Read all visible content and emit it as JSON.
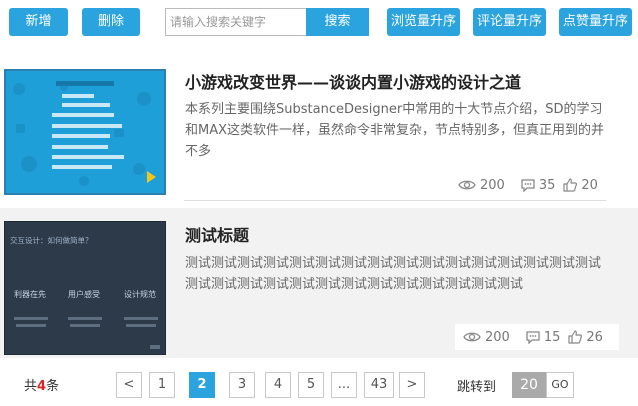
{
  "toolbar": {
    "add_label": "新增",
    "delete_label": "删除",
    "search_placeholder": "请输入搜索关键字",
    "search_label": "搜索",
    "sort_views_label": "浏览量升序",
    "sort_comments_label": "评论量升序",
    "sort_likes_label": "点赞量升序"
  },
  "articles": [
    {
      "title": "小游戏改变世界——谈谈内置小游戏的设计之道",
      "description": "本系列主要围绕SubstanceDesigner中常用的十大节点介绍，SD的学习和MAX这类软件一样，虽然命令非常复杂，节点特别多，但真正用到的并不多",
      "views": "200",
      "comments": "35",
      "likes": "20",
      "thumb_color": "#1e9fd8"
    },
    {
      "title": "测试标题",
      "description": "测试测试测试测试测试测试测试测试测试测试测试测试测试测试测试测试测试测试测试测试测试测试测试测试测试测试测试测试测试",
      "views": "200",
      "comments": "15",
      "likes": "26",
      "thumb_color": "#2c3a4a",
      "thumb_heading": "交互设计：如何做简单？",
      "thumb_items": [
        "利器在先",
        "用户感受",
        "设计规范"
      ]
    }
  ],
  "pagination": {
    "total_prefix": "共",
    "total_count": "4",
    "total_suffix": "条",
    "prev": "<",
    "pages": [
      "1",
      "2",
      "3",
      "4",
      "5",
      "...",
      "43"
    ],
    "current": "2",
    "next": ">",
    "jump_label": "跳转到",
    "jump_value": "20",
    "go_label": "GO"
  }
}
